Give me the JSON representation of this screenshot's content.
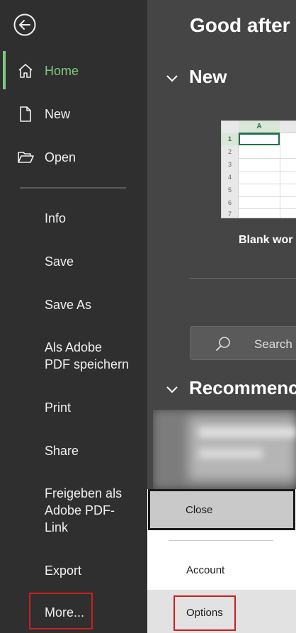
{
  "colors": {
    "accent": "#7fc97f",
    "highlight_box": "#cc1f1f",
    "excel_green": "#217346"
  },
  "sidebar": {
    "back_icon": "back-arrow-icon",
    "nav": [
      {
        "label": "Home",
        "icon": "home-icon",
        "active": true
      },
      {
        "label": "New",
        "icon": "new-document-icon",
        "active": false
      },
      {
        "label": "Open",
        "icon": "folder-open-icon",
        "active": false
      }
    ],
    "items": [
      {
        "label": "Info"
      },
      {
        "label": "Save"
      },
      {
        "label": "Save As"
      },
      {
        "label": "Als Adobe\nPDF speichern"
      },
      {
        "label": "Print"
      },
      {
        "label": "Share"
      },
      {
        "label": "Freigeben als\nAdobe PDF-\nLink"
      },
      {
        "label": "Export"
      },
      {
        "label": "More..."
      }
    ]
  },
  "main": {
    "greeting": "Good after",
    "new_section": "New",
    "template": {
      "label": "Blank wor",
      "column_header": "A",
      "row_numbers": [
        "1",
        "2",
        "3",
        "4",
        "5",
        "6",
        "7"
      ]
    },
    "search_label": "Search",
    "recommended_section": "Recommenc"
  },
  "menu": {
    "close": "Close",
    "account": "Account",
    "options": "Options"
  }
}
